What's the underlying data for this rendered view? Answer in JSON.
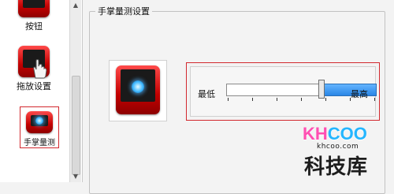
{
  "nav": {
    "items": [
      {
        "label": "按钮"
      },
      {
        "label": "拖放设置"
      },
      {
        "label": "手掌量测"
      }
    ]
  },
  "settings": {
    "group_title": "手掌量测设置",
    "slider": {
      "low_label": "最低",
      "high_label": "最高",
      "value_fraction": 0.63,
      "tick_count": 7
    }
  },
  "watermark": {
    "logo_kh": "KH",
    "logo_coo": "COO",
    "url": "khcoo.com",
    "name": "科技库"
  },
  "colors": {
    "accent_red": "#d2282e",
    "slider_fill": "#2a86e6"
  }
}
